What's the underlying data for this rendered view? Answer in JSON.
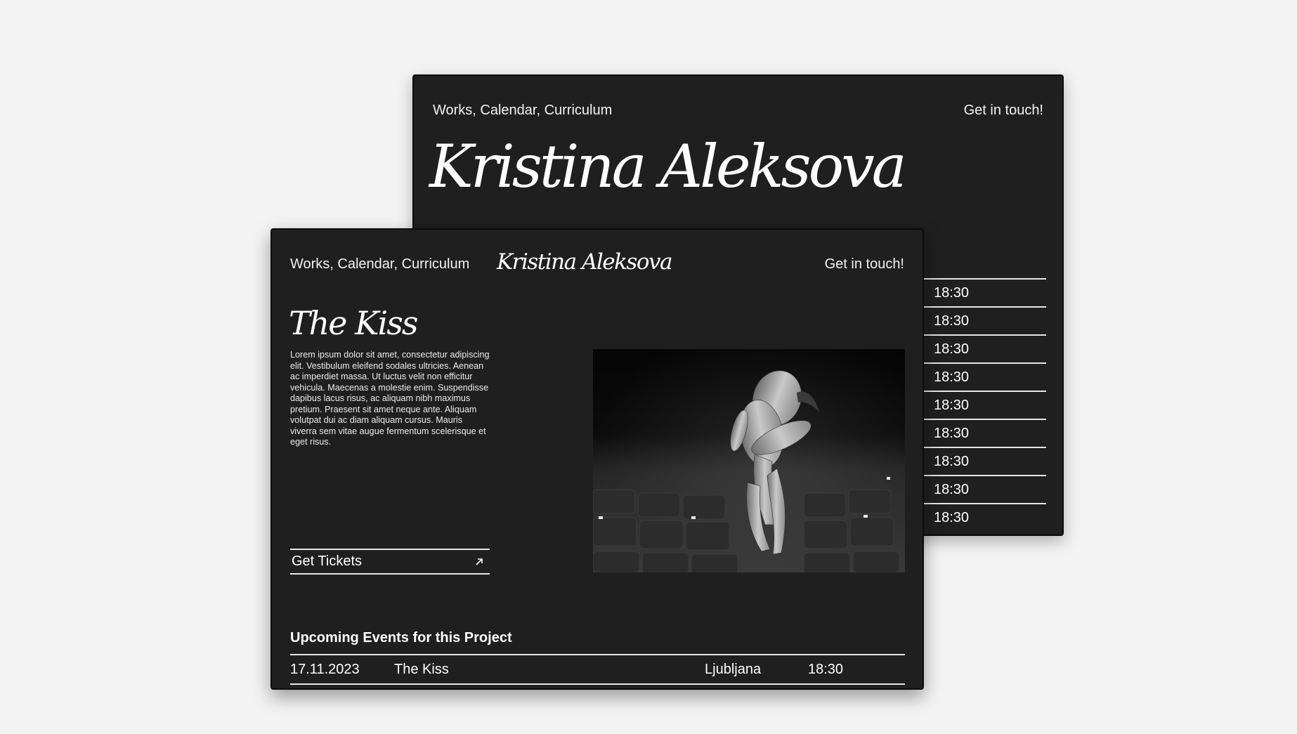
{
  "back_card": {
    "nav_left": "Works, Calendar, Curriculum",
    "nav_right": "Get in touch!",
    "hero_name": "Kristina Aleksova",
    "schedule_times": [
      "18:30",
      "18:30",
      "18:30",
      "18:30",
      "18:30",
      "18:30",
      "18:30",
      "18:30",
      "18:30"
    ]
  },
  "front_card": {
    "nav_left": "Works, Calendar, Curriculum",
    "logo": "Kristina Aleksova",
    "nav_right": "Get in touch!",
    "project_title": "The Kiss",
    "description": "Lorem ipsum dolor sit amet, consectetur adipiscing elit. Vestibulum eleifend sodales ultricies. Aenean ac imperdiet massa. Ut luctus velit non efficitur vehicula. Maecenas a molestie enim. Suspendisse dapibus lacus risus, ac aliquam nibh maximus pretium. Praesent sit amet neque ante. Aliquam volutpat dui ac diam aliquam cursus. Mauris viverra sem vitae augue fermentum scelerisque et eget risus.",
    "tickets_label": "Get Tickets",
    "tickets_icon": "arrow-up-right-icon",
    "events_heading": "Upcoming Events for this Project",
    "event": {
      "date": "17.11.2023",
      "title": "The Kiss",
      "city": "Ljubljana",
      "time": "18:30"
    }
  },
  "colors": {
    "page_bg": "#f3f3f3",
    "card_bg": "#1f1f1f",
    "text": "#ffffff"
  }
}
